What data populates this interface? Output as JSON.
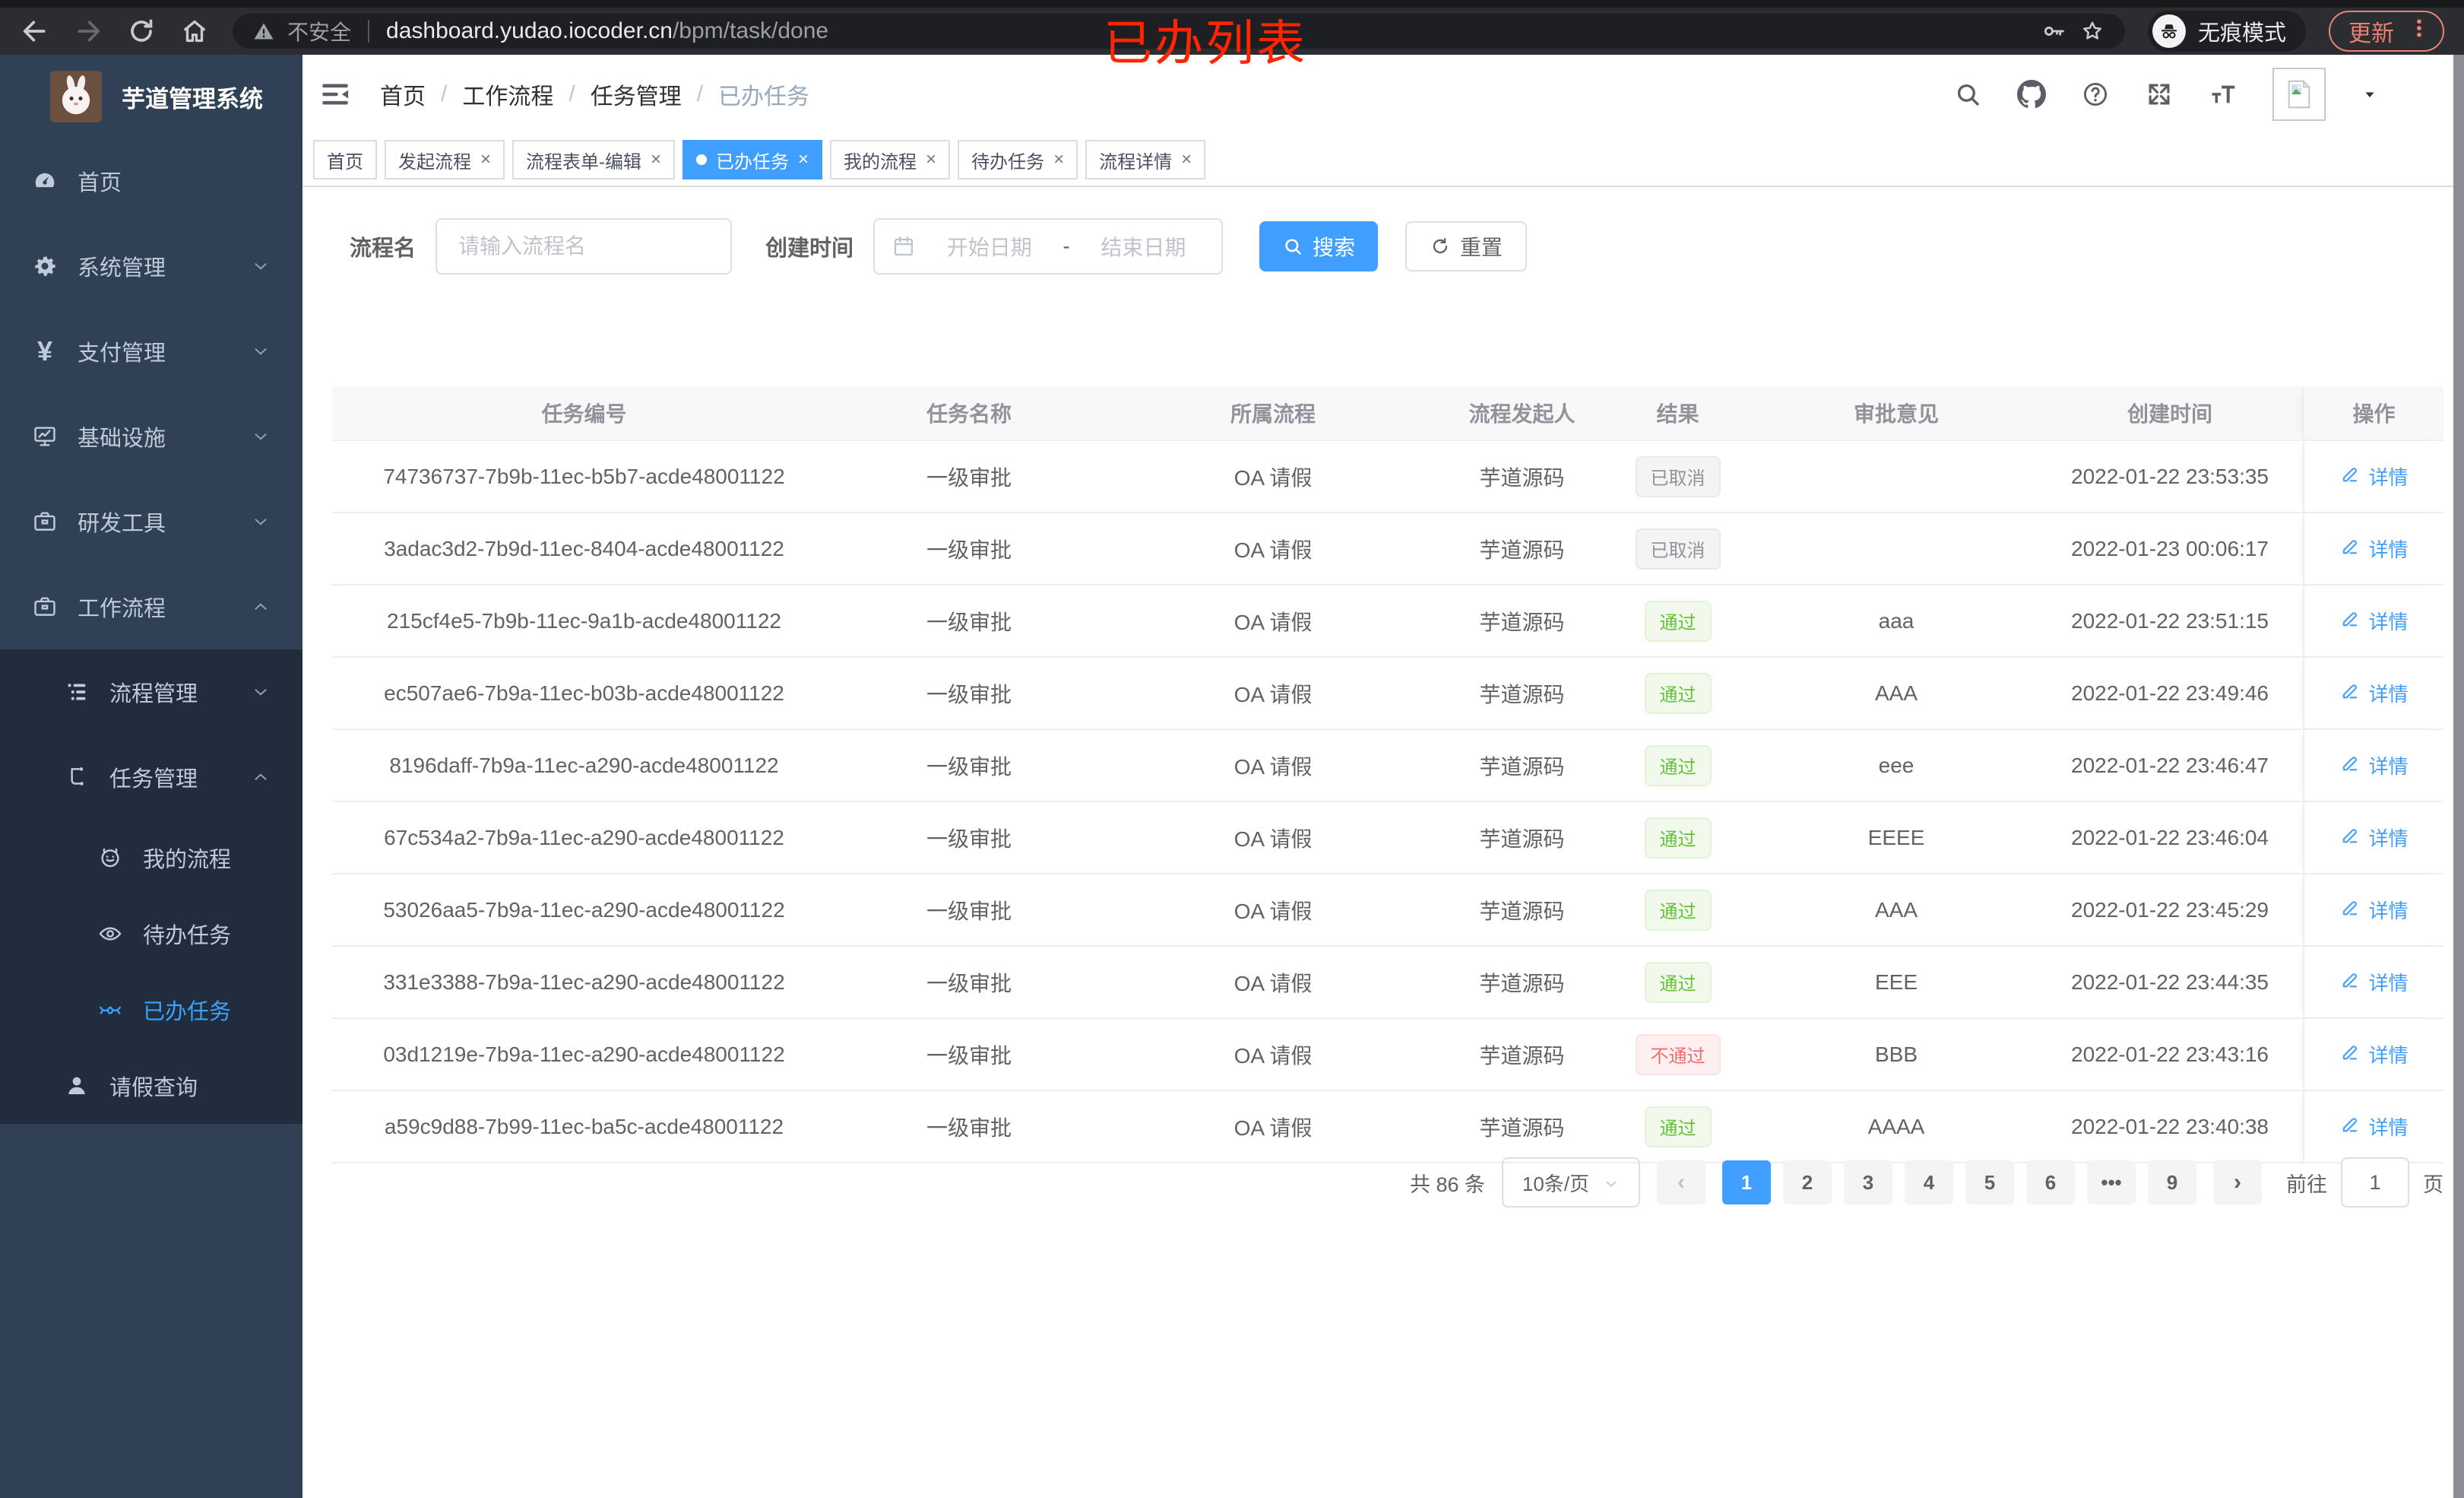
{
  "browser": {
    "insecure_label": "不安全",
    "url_host": "dashboard.yudao.iocoder.cn",
    "url_path": "/bpm/task/done",
    "incognito_label": "无痕模式",
    "update_label": "更新"
  },
  "annotation": {
    "text": "已办列表",
    "color": "#ff2500"
  },
  "sidebar": {
    "title": "芋道管理系统",
    "menu": [
      {
        "key": "home",
        "label": "首页",
        "icon": "dashboard-icon"
      },
      {
        "key": "system",
        "label": "系统管理",
        "icon": "gear-icon",
        "arrow": "down"
      },
      {
        "key": "payment",
        "label": "支付管理",
        "icon": "yen-icon",
        "arrow": "down"
      },
      {
        "key": "infra",
        "label": "基础设施",
        "icon": "monitor-icon",
        "arrow": "down"
      },
      {
        "key": "devtools",
        "label": "研发工具",
        "icon": "toolbox-icon",
        "arrow": "down"
      },
      {
        "key": "workflow",
        "label": "工作流程",
        "icon": "briefcase-icon",
        "arrow": "up"
      }
    ],
    "submenu": [
      {
        "key": "process-mgmt",
        "label": "流程管理",
        "icon": "flow-list-icon",
        "arrow": "down",
        "level": 2
      },
      {
        "key": "task-mgmt",
        "label": "任务管理",
        "icon": "task-tree-icon",
        "arrow": "up",
        "level": 2
      },
      {
        "key": "my-process",
        "label": "我的流程",
        "icon": "user-face-icon",
        "level": 3
      },
      {
        "key": "todo-tasks",
        "label": "待办任务",
        "icon": "eye-open-icon",
        "level": 3
      },
      {
        "key": "done-tasks",
        "label": "已办任务",
        "icon": "eye-closed-icon",
        "level": 3,
        "active": true
      },
      {
        "key": "leave-query",
        "label": "请假查询",
        "icon": "person-icon",
        "level": 2,
        "short": true
      }
    ]
  },
  "navbar": {
    "breadcrumb": [
      "首页",
      "工作流程",
      "任务管理",
      "已办任务"
    ],
    "separator": "/"
  },
  "tabs": [
    {
      "key": "home",
      "label": "首页",
      "closable": false
    },
    {
      "key": "start-process",
      "label": "发起流程",
      "closable": true
    },
    {
      "key": "form-edit",
      "label": "流程表单-编辑",
      "closable": true
    },
    {
      "key": "done-tasks",
      "label": "已办任务",
      "closable": true,
      "active": true
    },
    {
      "key": "my-process",
      "label": "我的流程",
      "closable": true
    },
    {
      "key": "todo-tasks",
      "label": "待办任务",
      "closable": true
    },
    {
      "key": "process-detail",
      "label": "流程详情",
      "closable": true
    }
  ],
  "filters": {
    "name_label": "流程名",
    "name_placeholder": "请输入流程名",
    "time_label": "创建时间",
    "start_placeholder": "开始日期",
    "range_separator": "-",
    "end_placeholder": "结束日期",
    "search_label": "搜索",
    "reset_label": "重置"
  },
  "table": {
    "columns": [
      "任务编号",
      "任务名称",
      "所属流程",
      "流程发起人",
      "结果",
      "审批意见",
      "创建时间",
      "操作"
    ],
    "detail_label": "详情",
    "rows": [
      {
        "id": "74736737-7b9b-11ec-b5b7-acde48001122",
        "name": "一级审批",
        "process": "OA 请假",
        "starter": "芋道源码",
        "result": "已取消",
        "result_type": "info",
        "comment": "",
        "created": "2022-01-22 23:53:35"
      },
      {
        "id": "3adac3d2-7b9d-11ec-8404-acde48001122",
        "name": "一级审批",
        "process": "OA 请假",
        "starter": "芋道源码",
        "result": "已取消",
        "result_type": "info",
        "comment": "",
        "created": "2022-01-23 00:06:17"
      },
      {
        "id": "215cf4e5-7b9b-11ec-9a1b-acde48001122",
        "name": "一级审批",
        "process": "OA 请假",
        "starter": "芋道源码",
        "result": "通过",
        "result_type": "success",
        "comment": "aaa",
        "created": "2022-01-22 23:51:15"
      },
      {
        "id": "ec507ae6-7b9a-11ec-b03b-acde48001122",
        "name": "一级审批",
        "process": "OA 请假",
        "starter": "芋道源码",
        "result": "通过",
        "result_type": "success",
        "comment": "AAA",
        "created": "2022-01-22 23:49:46"
      },
      {
        "id": "8196daff-7b9a-11ec-a290-acde48001122",
        "name": "一级审批",
        "process": "OA 请假",
        "starter": "芋道源码",
        "result": "通过",
        "result_type": "success",
        "comment": "eee",
        "created": "2022-01-22 23:46:47"
      },
      {
        "id": "67c534a2-7b9a-11ec-a290-acde48001122",
        "name": "一级审批",
        "process": "OA 请假",
        "starter": "芋道源码",
        "result": "通过",
        "result_type": "success",
        "comment": "EEEE",
        "created": "2022-01-22 23:46:04"
      },
      {
        "id": "53026aa5-7b9a-11ec-a290-acde48001122",
        "name": "一级审批",
        "process": "OA 请假",
        "starter": "芋道源码",
        "result": "通过",
        "result_type": "success",
        "comment": "AAA",
        "created": "2022-01-22 23:45:29"
      },
      {
        "id": "331e3388-7b9a-11ec-a290-acde48001122",
        "name": "一级审批",
        "process": "OA 请假",
        "starter": "芋道源码",
        "result": "通过",
        "result_type": "success",
        "comment": "EEE",
        "created": "2022-01-22 23:44:35"
      },
      {
        "id": "03d1219e-7b9a-11ec-a290-acde48001122",
        "name": "一级审批",
        "process": "OA 请假",
        "starter": "芋道源码",
        "result": "不通过",
        "result_type": "danger",
        "comment": "BBB",
        "created": "2022-01-22 23:43:16"
      },
      {
        "id": "a59c9d88-7b99-11ec-ba5c-acde48001122",
        "name": "一级审批",
        "process": "OA 请假",
        "starter": "芋道源码",
        "result": "通过",
        "result_type": "success",
        "comment": "AAAA",
        "created": "2022-01-22 23:40:38"
      }
    ]
  },
  "pagination": {
    "total_label": "共 86 条",
    "page_size_label": "10条/页",
    "pages": [
      {
        "label": "1",
        "active": true
      },
      {
        "label": "2"
      },
      {
        "label": "3"
      },
      {
        "label": "4"
      },
      {
        "label": "5"
      },
      {
        "label": "6"
      },
      {
        "label": "•••",
        "ellipsis": true
      },
      {
        "label": "9"
      }
    ],
    "prev_glyph": "‹",
    "next_glyph": "›",
    "goto_label": "前往",
    "goto_value": "1",
    "page_unit": "页"
  },
  "colors": {
    "accent": "#409eff",
    "success": "#67c23a",
    "danger": "#f56c6c",
    "info": "#909399",
    "sidebar_bg": "#304156",
    "submenu_bg": "#1f2d3d",
    "update_chip": "#ec8075",
    "annotation": "#ff2500"
  }
}
